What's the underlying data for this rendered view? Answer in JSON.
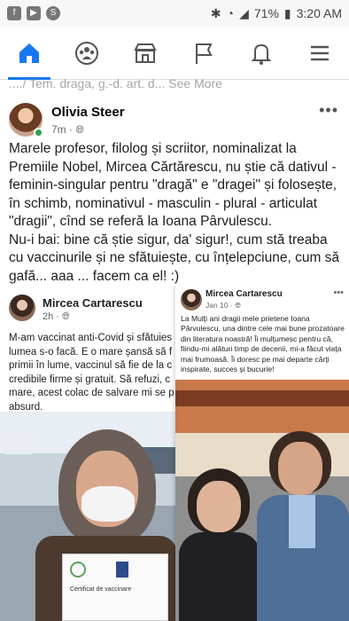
{
  "status_bar": {
    "battery": "71%",
    "time": "3:20 AM"
  },
  "nav": {
    "items": [
      "home",
      "groups",
      "marketplace",
      "pages",
      "notifications",
      "menu"
    ]
  },
  "previous_snippet": "..../ Tem. draga, g.-d. art. d... See More",
  "post": {
    "author": "Olivia Steer",
    "time": "7m",
    "visibility_icon": "globe-icon",
    "paragraph1": "Marele profesor, filolog și scriitor, nominalizat la Premiile Nobel, Mircea Cărtărescu, nu știe că dativul - feminin-singular pentru \"dragă\" e \"dragei\" și folosește, în schimb, nominativul -  masculin - plural - articulat \"dragii\", cînd se referă la Ioana Pârvulescu.",
    "paragraph2": "Nu-i bai: bine că știe sigur, da' sigur!, cum stă treaba cu vaccinurile și ne sfătuiește, cu înțelepciune, cum să gafă... aaa ... facem ca el! :)"
  },
  "shared_left": {
    "author": "Mircea Cartarescu",
    "time": "2h",
    "text_lines": [
      "M-am vaccinat anti-Covid și sfătuies",
      "lumea s-o facă. E o mare șansă să f",
      "primii în lume, vaccinul să fie de la c",
      "credibile firme și gratuit. Să refuzi, c",
      "mare, acest colac de salvare mi se p",
      "absurd."
    ],
    "paper_caption": "Certificat de vaccinare"
  },
  "shared_right": {
    "author": "Mircea Cartarescu",
    "time": "Jan 10",
    "text": "La Mulți ani dragii mele prietene Ioana Pârvulescu, una dintre cele mai bune prozatoare din literatura noastră! Îi mulțumesc pentru că, fiindu-mi alături timp de decenii, mi-a făcut viața mai frumoasă. Îi doresc pe mai departe cărți inspirate, succes și bucurie!"
  }
}
